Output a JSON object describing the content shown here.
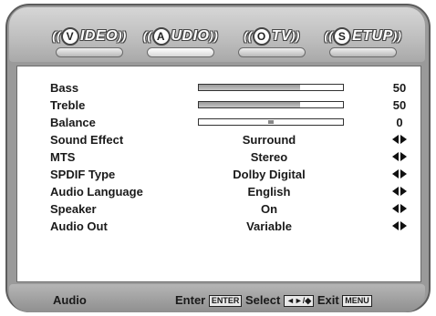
{
  "tabs": [
    {
      "badge": "V",
      "text": "IDEO",
      "active": false
    },
    {
      "badge": "A",
      "text": "UDIO",
      "active": true
    },
    {
      "badge": "O",
      "text": "TV",
      "active": false
    },
    {
      "badge": "S",
      "text": "ETUP",
      "active": false
    }
  ],
  "menu": {
    "bass": {
      "label": "Bass",
      "value": "50",
      "level": 0.7
    },
    "treble": {
      "label": "Treble",
      "value": "50",
      "level": 0.7
    },
    "balance": {
      "label": "Balance",
      "value": "0",
      "level": 0.5
    },
    "sound_effect": {
      "label": "Sound Effect",
      "value": "Surround"
    },
    "mts": {
      "label": "MTS",
      "value": "Stereo"
    },
    "spdif": {
      "label": "SPDIF Type",
      "value": "Dolby Digital"
    },
    "audio_language": {
      "label": "Audio Language",
      "value": "English"
    },
    "speaker": {
      "label": "Speaker",
      "value": "On"
    },
    "audio_out": {
      "label": "Audio Out",
      "value": "Variable"
    }
  },
  "footer": {
    "title": "Audio",
    "enter_label": "Enter",
    "enter_key": "ENTER",
    "select_label": "Select",
    "select_key": "◄►/◆",
    "exit_label": "Exit",
    "exit_key": "MENU"
  },
  "colors": {
    "frame": "#9a9a9a",
    "panel": "#ffffff",
    "bar_fill": "#9a9a9a"
  },
  "icons": {
    "adjust": "left-right-arrows-icon"
  }
}
